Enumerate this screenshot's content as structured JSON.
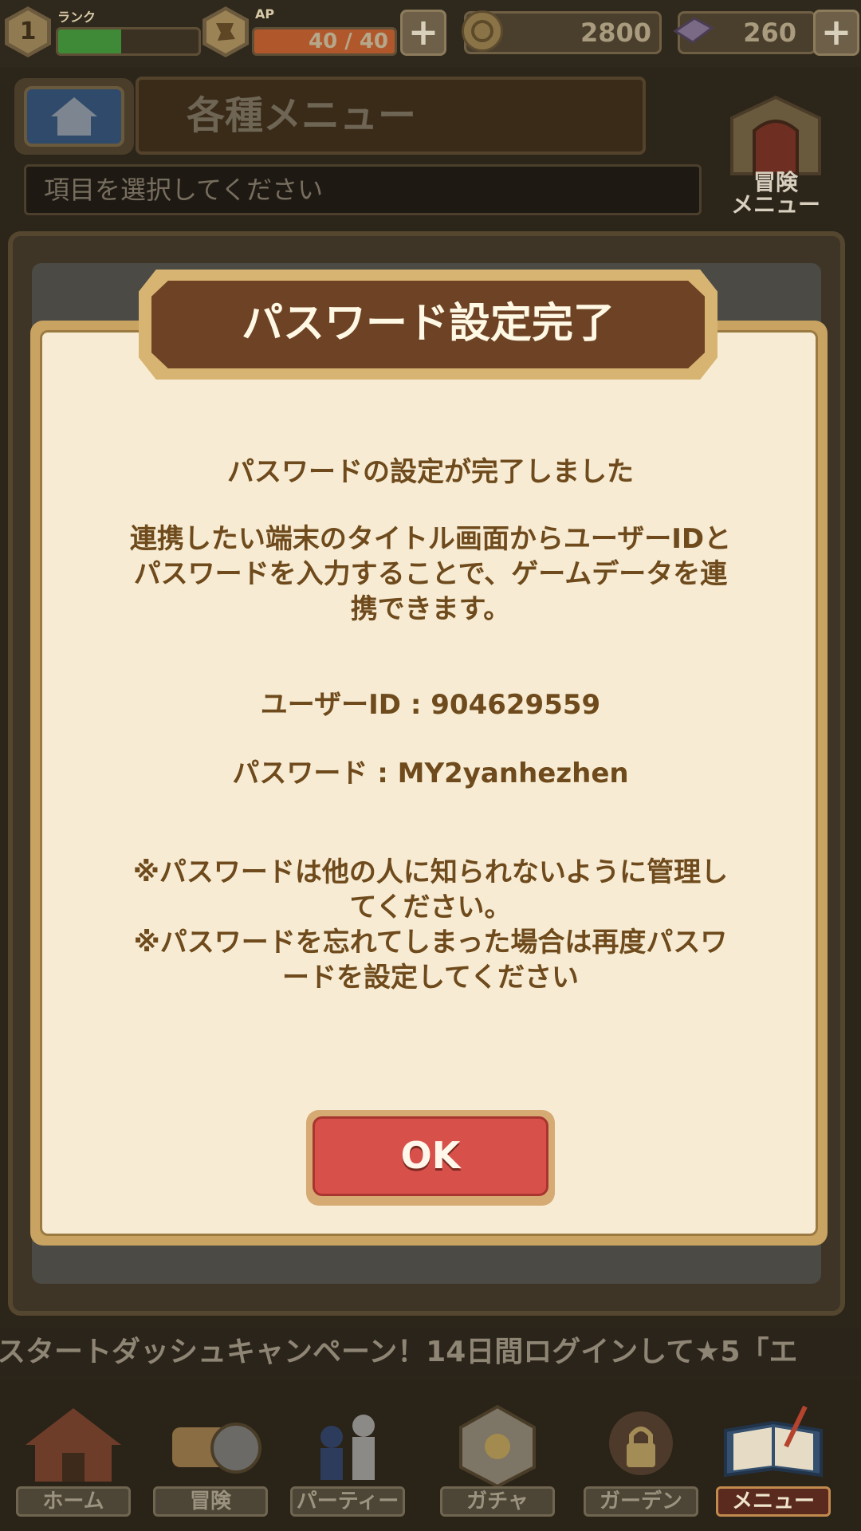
{
  "status": {
    "rank_level": "1",
    "rank_label": "ランク",
    "rank_progress": 0.45,
    "ap_label": "AP",
    "ap_value": "40 / 40",
    "ap_progress": 1.0,
    "coins": "2800",
    "gems": "260"
  },
  "header": {
    "title": "各種メニュー",
    "subtitle": "項目を選択してください",
    "adventure_menu_line1": "冒険",
    "adventure_menu_line2": "メニュー"
  },
  "dialog": {
    "title": "パスワード設定完了",
    "line_done": "パスワードの設定が完了しました",
    "line_link_1": "連携したい端末のタイトル画面からユーザーIDと",
    "line_link_2": "パスワードを入力することで、ゲームデータを連",
    "line_link_3": "携できます。",
    "user_id_line": "ユーザーID : 904629559",
    "password_line": "パスワード : MY2yanhezhen",
    "note_1a": "※パスワードは他の人に知られないように管理し",
    "note_1b": "てください。",
    "note_2a": "※パスワードを忘れてしまった場合は再度パスワ",
    "note_2b": "ードを設定してください",
    "ok_label": "OK"
  },
  "ticker": {
    "text": "スタートダッシュキャンペーン！14日間ログインして★5「エ"
  },
  "nav": {
    "items": [
      {
        "label": "ホーム",
        "icon": "house-icon"
      },
      {
        "label": "冒険",
        "icon": "scroll-compass-icon"
      },
      {
        "label": "パーティー",
        "icon": "chess-pieces-icon"
      },
      {
        "label": "ガチャ",
        "icon": "gacha-dice-icon"
      },
      {
        "label": "ガーデン",
        "icon": "locked-garden-icon"
      },
      {
        "label": "メニュー",
        "icon": "book-quill-icon"
      }
    ]
  },
  "colors": {
    "dialog_text": "#6e4a1c",
    "ok_button": "#d8504a",
    "title_plate": "#6e4325",
    "dialog_bg": "#f7ecd3"
  }
}
